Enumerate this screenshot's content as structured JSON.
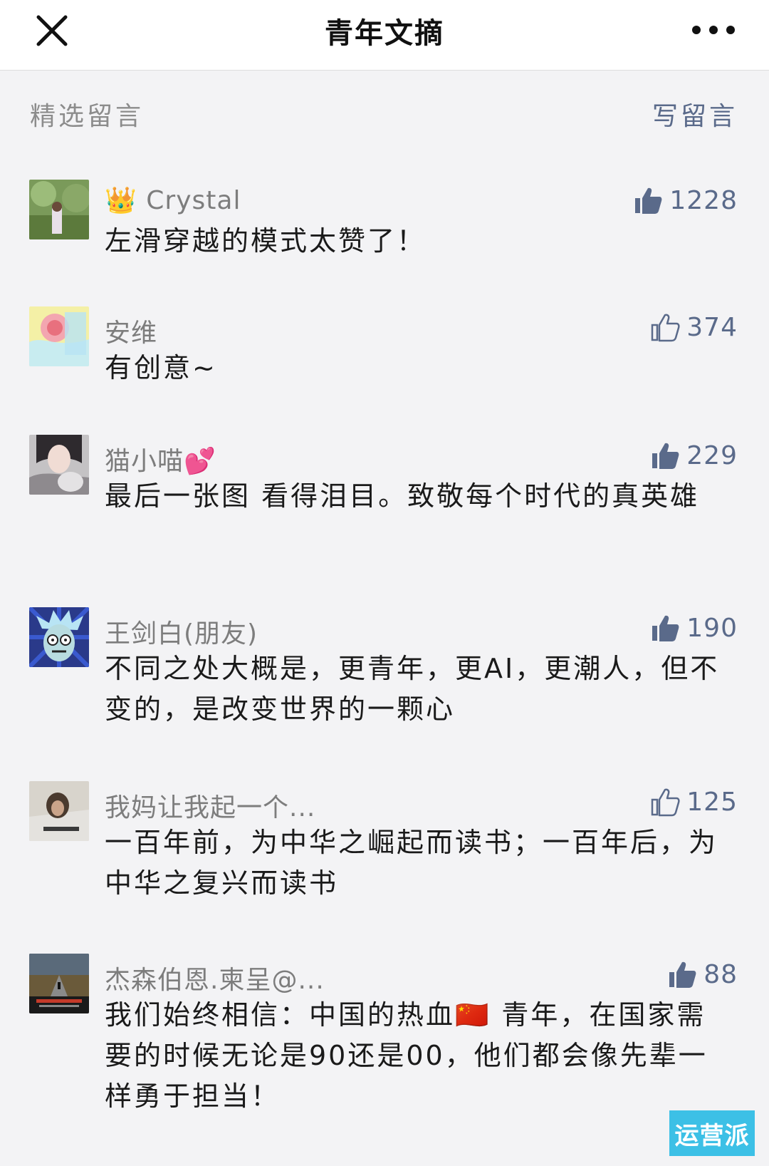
{
  "header": {
    "title": "青年文摘",
    "close_icon": "close-icon",
    "more_icon": "more-dots-icon"
  },
  "section": {
    "title": "精选留言",
    "write_label": "写留言"
  },
  "comments": [
    {
      "nick": "👑 Crystal",
      "likes": "1228",
      "liked": true,
      "text": "左滑穿越的模式太赞了！"
    },
    {
      "nick": "安维",
      "likes": "374",
      "liked": false,
      "text": "有创意~"
    },
    {
      "nick": "猫小喵💕",
      "likes": "229",
      "liked": true,
      "text": "最后一张图 看得泪目。致敬每个时代的真英雄"
    },
    {
      "nick": "王剑白(朋友)",
      "likes": "190",
      "liked": true,
      "text": "不同之处大概是，更青年，更AI，更潮人，但不变的，是改变世界的一颗心"
    },
    {
      "nick": "我妈让我起一个...",
      "likes": "125",
      "liked": false,
      "text": "一百年前，为中华之崛起而读书；一百年后，为中华之复兴而读书"
    },
    {
      "nick": "杰森伯恩.柬呈@...",
      "likes": "88",
      "liked": true,
      "text": "我们始终相信：中国的热血🇨🇳 青年，在国家需要的时候无论是90还是00，他们都会像先辈一样勇于担当！"
    }
  ],
  "watermark": "运营派",
  "colors": {
    "link": "#5a6a8a",
    "background": "#f3f3f5",
    "watermark": "#3cc0e6"
  }
}
